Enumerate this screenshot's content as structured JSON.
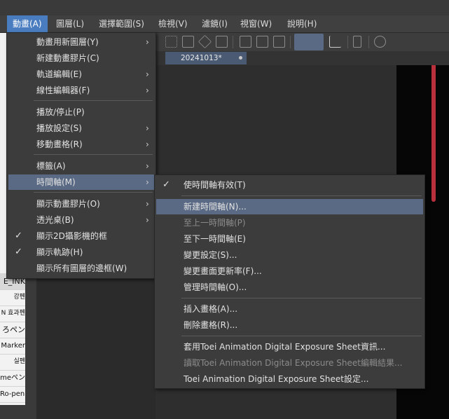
{
  "menubar": {
    "items": [
      "動畫(A)",
      "圖層(L)",
      "選擇範圍(S)",
      "檢視(V)",
      "濾鏡(I)",
      "視窗(W)",
      "說明(H)"
    ],
    "active_index": 0
  },
  "tab": {
    "label": "20241013*"
  },
  "left_panel": {
    "rows": [
      "E_INK",
      "강펜",
      "N 효과펜",
      "ろペン",
      "Marker",
      "실펜",
      "meペン",
      "Ro-pen)"
    ]
  },
  "animation_menu": {
    "items": [
      {
        "label": "動畫用新圖層(Y)",
        "submenu": true
      },
      {
        "label": "新建動畫膠片(C)"
      },
      {
        "label": "軌道編輯(E)",
        "submenu": true
      },
      {
        "label": "線性編輯器(F)",
        "submenu": true
      },
      {
        "label": "播放/停止(P)"
      },
      {
        "label": "播放設定(S)",
        "submenu": true
      },
      {
        "label": "移動畫格(R)",
        "submenu": true
      },
      {
        "label": "標籤(A)",
        "submenu": true
      },
      {
        "label": "時間軸(M)",
        "submenu": true,
        "highlighted": true
      },
      {
        "label": "顯示動畫膠片(O)",
        "submenu": true
      },
      {
        "label": "透光桌(B)",
        "submenu": true
      },
      {
        "label": "顯示2D攝影機的框",
        "checked": true
      },
      {
        "label": "顯示軌跡(H)",
        "checked": true
      },
      {
        "label": "顯示所有圖層的邊框(W)"
      }
    ]
  },
  "timeline_submenu": {
    "items": [
      {
        "label": "使時間軸有效(T)",
        "checked": true
      },
      {
        "label": "新建時間軸(N)...",
        "highlighted": true
      },
      {
        "label": "至上一時間軸(P)",
        "disabled": true
      },
      {
        "label": "至下一時間軸(E)"
      },
      {
        "label": "變更設定(S)..."
      },
      {
        "label": "變更畫面更新率(F)..."
      },
      {
        "label": "管理時間軸(O)..."
      },
      {
        "label": "插入畫格(A)..."
      },
      {
        "label": "刪除畫格(R)..."
      },
      {
        "label": "套用Toei Animation Digital Exposure Sheet資訊..."
      },
      {
        "label": "讀取Toei Animation Digital Exposure Sheet編輯結果...",
        "disabled": true
      },
      {
        "label": "Toei Animation Digital Exposure Sheet設定..."
      }
    ]
  },
  "icons": {
    "checkmark": "✓",
    "submenu_arrow": "›"
  },
  "colors": {
    "menubar_active": "#4a7dbf",
    "menu_highlight": "#5a6a84",
    "accent_red": "#b8303c"
  }
}
